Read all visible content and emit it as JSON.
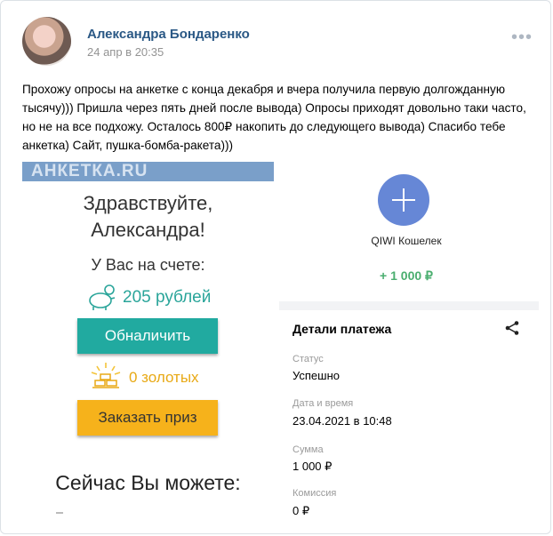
{
  "post": {
    "author": "Александра Бондаренко",
    "date": "24 апр в 20:35",
    "more": "•••",
    "text": "Прохожу опросы на анкетке с конца декабря и вчера получила первую долгожданную тысячу))) Пришла через пять дней после вывода) Опросы приходят довольно таки часто, но не на все подхожу. Осталось 800₽ накопить до следующего вывода) Спасибо тебе анкетка) Сайт, пушка-бомба-ракета)))"
  },
  "left": {
    "logo": "АНКЕТКА.RU",
    "greeting": "Здравствуйте,\nАлександра!",
    "account_label": "У Вас на счете:",
    "rubles": "205 рублей",
    "withdraw_button": "Обналичить",
    "gold": "0 золотых",
    "prize_button": "Заказать приз",
    "can_do": "Сейчас Вы можете:"
  },
  "right": {
    "wallet": "QIWI Кошелек",
    "amount": "+ 1 000 ₽",
    "details_title": "Детали платежа",
    "status_label": "Статус",
    "status_value": "Успешно",
    "datetime_label": "Дата и время",
    "datetime_value": "23.04.2021 в 10:48",
    "sum_label": "Сумма",
    "sum_value": "1 000 ₽",
    "fee_label": "Комиссия",
    "fee_value": "0 ₽"
  },
  "colors": {
    "author": "#2a5885",
    "teal": "#21aaa0",
    "orange": "#f6b21b",
    "qiwi_blue": "#6687d6",
    "green_amount": "#4aae6f"
  },
  "icons": [
    "more-icon",
    "piggy-bank-icon",
    "gold-bars-icon",
    "plus-icon",
    "share-icon"
  ]
}
